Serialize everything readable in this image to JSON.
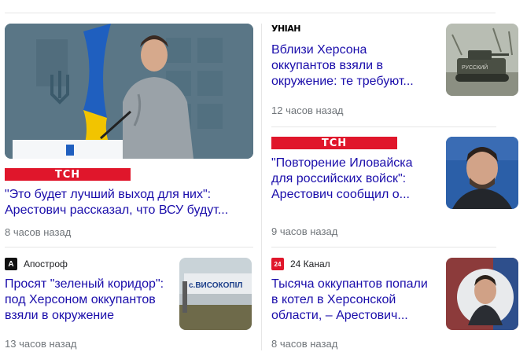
{
  "feed": {
    "left": {
      "featured": {
        "source_logo": "ТСН",
        "title": "\"Это будет лучший выход для них\": Арестович рассказал, что ВСУ будут...",
        "time": "8 часов назад"
      },
      "item": {
        "source_name": "Апостроф",
        "source_icon": "A",
        "title": "Просят \"зеленый коридор\": под Херсоном оккупантов взяли в окружение",
        "time": "13 часов назад",
        "image_sign_text": "с.ВИСОКОПІЛ"
      }
    },
    "right": {
      "items": [
        {
          "source_logo": "УНІАН",
          "title": "Вблизи Херсона оккупантов взяли в окружение: те требуют...",
          "time": "12 часов назад",
          "image_label": "РУССКИЙ"
        },
        {
          "source_logo": "ТСН",
          "title": "\"Повторение Иловайска для российских войск\": Арестович сообщил о...",
          "time": "9 часов назад"
        },
        {
          "source_name": "24 Канал",
          "source_icon": "24",
          "title": "Тысяча оккупантов попали в котел в Херсонской области, – Арестович...",
          "time": "8 часов назад"
        }
      ]
    }
  },
  "colors": {
    "title_link": "#1a0dab",
    "tsn_red": "#e0162b",
    "time_gray": "#70757a",
    "divider": "#e6e6e6"
  }
}
